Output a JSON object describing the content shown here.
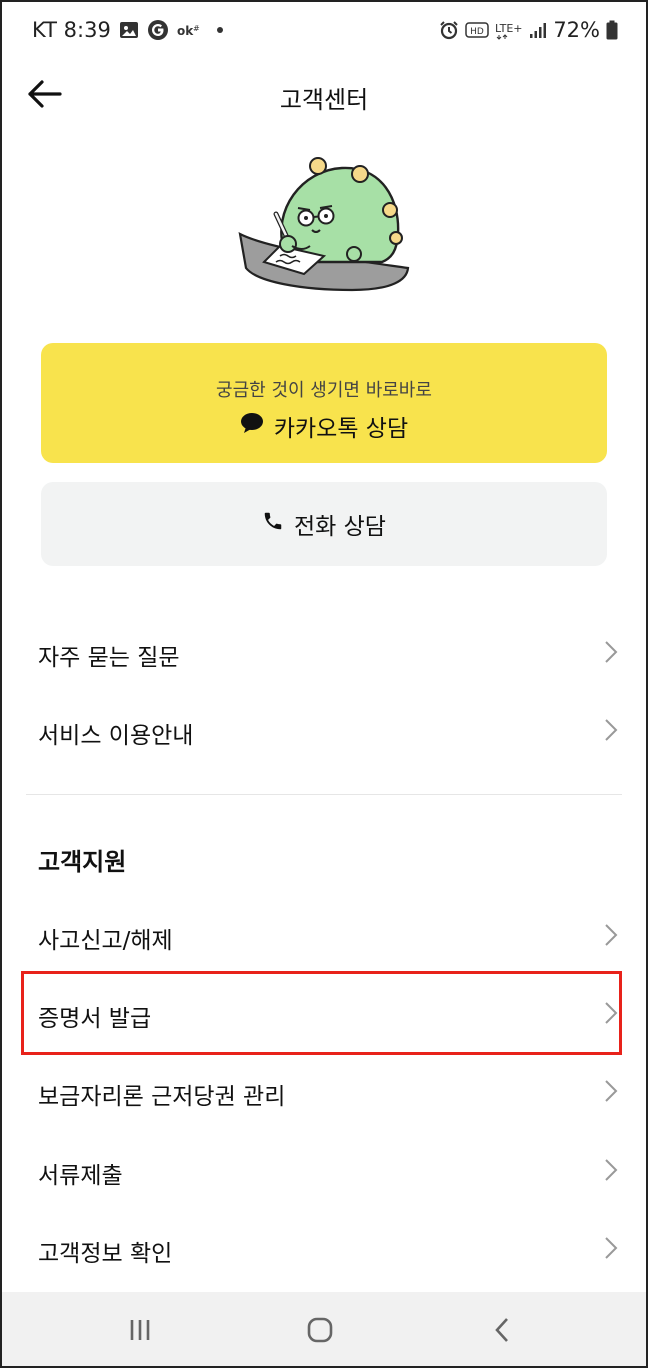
{
  "status_bar": {
    "carrier_time": "KT 8:39",
    "hd": "HD",
    "network": "LTE+",
    "battery": "72%"
  },
  "header": {
    "title": "고객센터"
  },
  "kakao_button": {
    "subtitle": "궁금한 것이 생기면 바로바로",
    "label": "카카오톡 상담"
  },
  "phone_button": {
    "label": "전화 상담"
  },
  "menu_top": [
    {
      "label": "자주 묻는 질문"
    },
    {
      "label": "서비스 이용안내"
    }
  ],
  "support": {
    "title": "고객지원",
    "items": [
      {
        "label": "사고신고/해제"
      },
      {
        "label": "증명서 발급"
      },
      {
        "label": "보금자리론 근저당권 관리"
      },
      {
        "label": "서류제출"
      },
      {
        "label": "고객정보 확인"
      }
    ]
  },
  "colors": {
    "kakao_yellow": "#f8e34d",
    "phone_gray": "#f2f3f3",
    "highlight_red": "#e8221a"
  }
}
